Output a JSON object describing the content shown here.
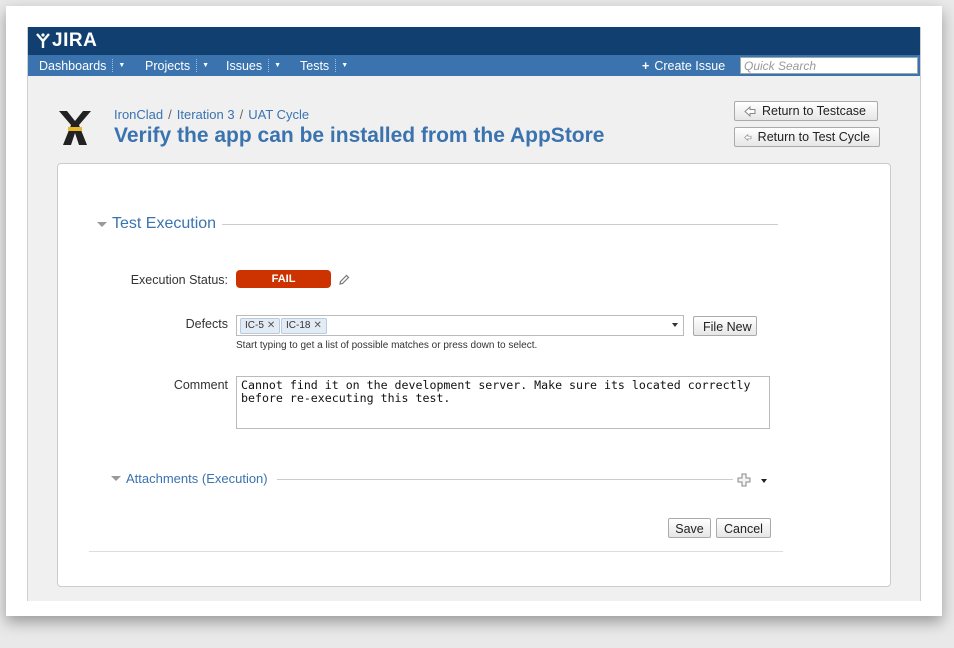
{
  "header": {
    "logo_text": "JIRA",
    "nav": [
      {
        "label": "Dashboards"
      },
      {
        "label": "Projects"
      },
      {
        "label": "Issues"
      },
      {
        "label": "Tests"
      }
    ],
    "create_issue_label": "Create Issue",
    "quick_search_placeholder": "Quick Search"
  },
  "breadcrumbs": [
    "IronClad",
    "Iteration 3",
    "UAT Cycle"
  ],
  "breadcrumb_separator": "/",
  "page_title": "Verify the app can be installed from the AppStore",
  "actions": {
    "return_testcase": "Return to Testcase",
    "return_test_cycle": "Return to Test Cycle"
  },
  "test_execution": {
    "section_title": "Test Execution",
    "status_label": "Execution Status:",
    "status_value": "FAIL",
    "status_color": "#cc3300",
    "defects_label": "Defects",
    "defects": [
      "IC-5",
      "IC-18"
    ],
    "defects_hint": "Start typing to get a list of possible matches or press down to select.",
    "file_new_label": "File New",
    "comment_label": "Comment",
    "comment_value": "Cannot find it on the development server. Make sure its located correctly before re-executing this test."
  },
  "attachments": {
    "section_title": "Attachments (Execution)"
  },
  "form_buttons": {
    "save": "Save",
    "cancel": "Cancel"
  },
  "theme": {
    "header_bg": "#114070",
    "nav_bg": "#3b73af",
    "link_color": "#3b73af"
  }
}
